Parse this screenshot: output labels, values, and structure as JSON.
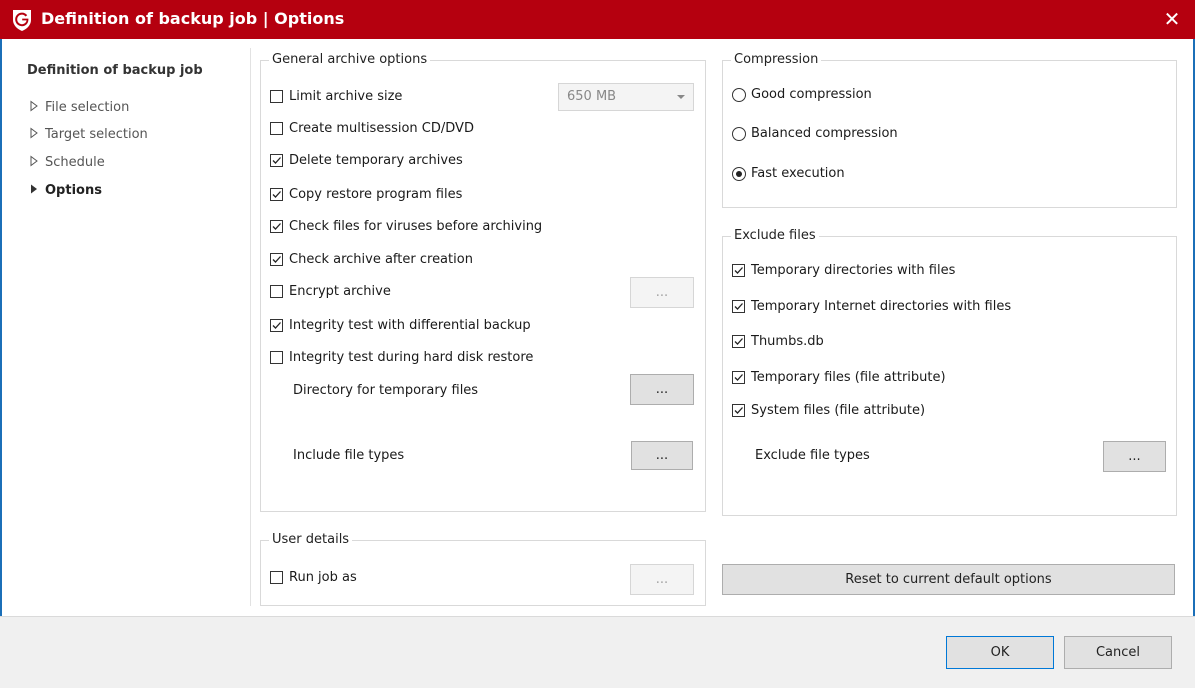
{
  "window": {
    "title": "Definition of backup job | Options",
    "close_symbol": "✕",
    "accent_color": "#b5000f"
  },
  "nav": {
    "heading": "Definition of backup job",
    "items": [
      {
        "label": "File selection",
        "active": false
      },
      {
        "label": "Target selection",
        "active": false
      },
      {
        "label": "Schedule",
        "active": false
      },
      {
        "label": "Options",
        "active": true
      }
    ]
  },
  "general": {
    "legend": "General archive options",
    "limit_size": {
      "label": "Limit archive size",
      "checked": false,
      "value": "650 MB"
    },
    "multisession": {
      "label": "Create multisession CD/DVD",
      "checked": false
    },
    "delete_temp": {
      "label": "Delete temporary archives",
      "checked": true
    },
    "copy_restore": {
      "label": "Copy restore program files",
      "checked": true
    },
    "check_viruses": {
      "label": "Check files for viruses before archiving",
      "checked": true
    },
    "check_archive": {
      "label": "Check archive after creation",
      "checked": true
    },
    "encrypt": {
      "label": "Encrypt archive",
      "checked": false,
      "button": "..."
    },
    "integrity_diff": {
      "label": "Integrity test with differential backup",
      "checked": true
    },
    "integrity_restore": {
      "label": "Integrity test during hard disk restore",
      "checked": false
    },
    "temp_dir": {
      "label": "Directory for temporary files",
      "button": "..."
    },
    "include_types": {
      "label": "Include file types",
      "button": "..."
    }
  },
  "user": {
    "legend": "User details",
    "run_as": {
      "label": "Run job as",
      "checked": false,
      "button": "..."
    }
  },
  "compression": {
    "legend": "Compression",
    "options": [
      {
        "label": "Good compression",
        "selected": false
      },
      {
        "label": "Balanced compression",
        "selected": false
      },
      {
        "label": "Fast execution",
        "selected": true
      }
    ]
  },
  "exclude": {
    "legend": "Exclude files",
    "items": [
      {
        "label": "Temporary directories with files",
        "checked": true
      },
      {
        "label": "Temporary Internet directories with files",
        "checked": true
      },
      {
        "label": "Thumbs.db",
        "checked": true
      },
      {
        "label": "Temporary files (file attribute)",
        "checked": true
      },
      {
        "label": "System files (file attribute)",
        "checked": true
      }
    ],
    "types": {
      "label": "Exclude file types",
      "button": "..."
    }
  },
  "reset_button": "Reset to current default options",
  "footer": {
    "ok": "OK",
    "cancel": "Cancel"
  },
  "icons": {
    "logo": "gdata-shield-icon",
    "close": "close-icon",
    "nav_arrow": "triangle-right-icon",
    "check": "checkmark-icon",
    "dropdown": "chevron-down-icon"
  }
}
